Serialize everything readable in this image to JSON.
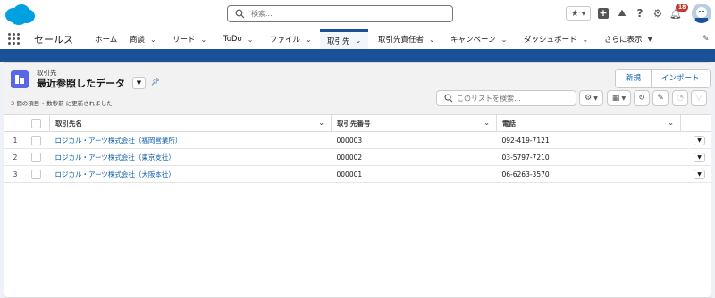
{
  "app": {
    "name": "セールス"
  },
  "header": {
    "search_placeholder": "検索...",
    "notification_count": "18"
  },
  "nav": {
    "items": [
      {
        "label": "ホーム",
        "has_menu": false
      },
      {
        "label": "商談",
        "has_menu": true
      },
      {
        "label": "リード",
        "has_menu": true
      },
      {
        "label": "ToDo",
        "has_menu": true
      },
      {
        "label": "ファイル",
        "has_menu": true
      },
      {
        "label": "取引先",
        "has_menu": true,
        "active": true
      },
      {
        "label": "取引先責任者",
        "has_menu": true
      },
      {
        "label": "キャンペーン",
        "has_menu": true
      },
      {
        "label": "ダッシュボード",
        "has_menu": true
      },
      {
        "label": "さらに表示",
        "has_menu": true
      }
    ]
  },
  "list_view": {
    "object_label": "取引先",
    "view_name": "最近参照したデータ",
    "meta": "3 個の項目 • 数秒前 に更新されました",
    "search_placeholder": "このリストを検索...",
    "buttons": {
      "new": "新規",
      "import": "インポート"
    },
    "columns": [
      "取引先名",
      "取引先番号",
      "電話"
    ],
    "rows": [
      {
        "num": "1",
        "name": "ロジカル・アーツ株式会社（福岡営業所）",
        "account_number": "000003",
        "phone": "092-419-7121"
      },
      {
        "num": "2",
        "name": "ロジカル・アーツ株式会社（東京支社）",
        "account_number": "000002",
        "phone": "03-5797-7210"
      },
      {
        "num": "3",
        "name": "ロジカル・アーツ株式会社（大阪本社）",
        "account_number": "000001",
        "phone": "06-6263-3570"
      }
    ]
  },
  "colors": {
    "brand": "#1b5297",
    "link": "#0b5cab",
    "object_icon": "#5867e8",
    "badge": "#c23934"
  }
}
